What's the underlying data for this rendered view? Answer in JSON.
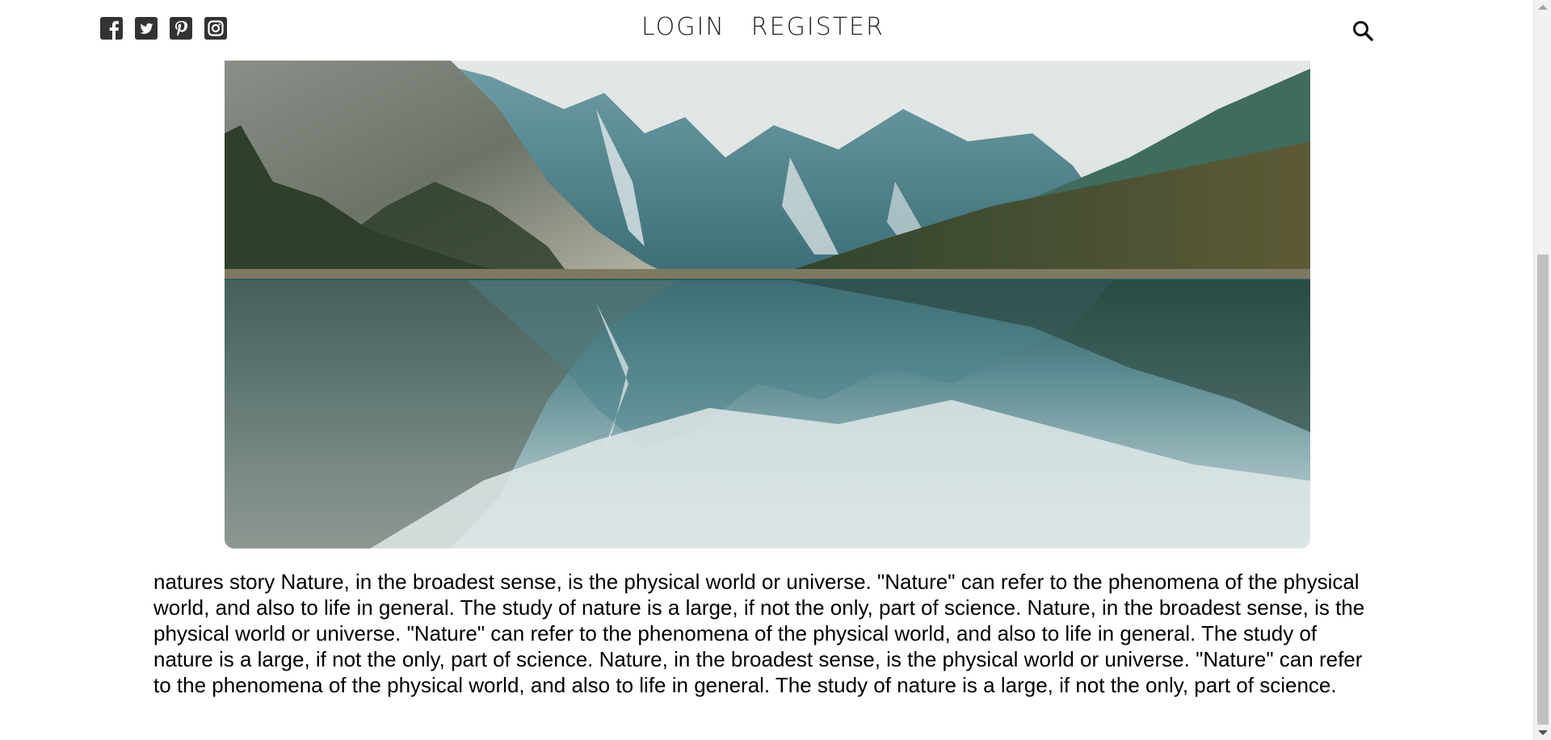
{
  "header": {
    "social_icons": [
      "facebook-icon",
      "twitter-icon",
      "pinterest-icon",
      "instagram-icon"
    ],
    "nav": {
      "login_label": "LOGIN",
      "register_label": "REGISTER"
    },
    "search_icon": "search-icon"
  },
  "hero": {
    "image": "mountain-lake-reflection"
  },
  "article": {
    "text": "natures story Nature, in the broadest sense, is the physical world or universe. \"Nature\" can refer to the phenomena of the physical world, and also to life in general. The study of nature is a large, if not the only, part of science. Nature, in the broadest sense, is the physical world or universe. \"Nature\" can refer to the phenomena of the physical world, and also to life in general. The study of nature is a large, if not the only, part of science. Nature, in the broadest sense, is the physical world or universe. \"Nature\" can refer to the phenomena of the physical world, and also to life in general. The study of nature is a large, if not the only, part of science."
  },
  "colors": {
    "icon": "#333333",
    "nav_text": "#222222",
    "body_text": "#000000"
  }
}
